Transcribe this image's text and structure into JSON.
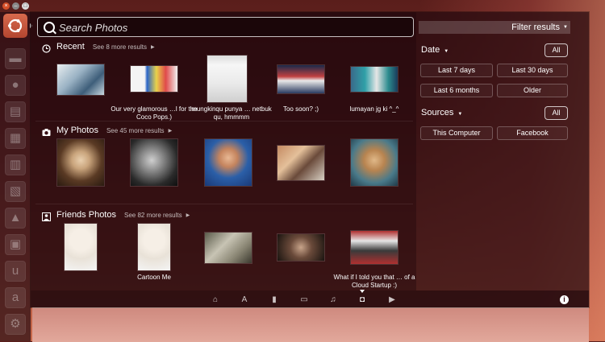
{
  "launcher": {
    "items": [
      "home-folder",
      "firefox",
      "files",
      "text-editor",
      "document",
      "spreadsheet",
      "presentation",
      "software-center",
      "ubuntu-one",
      "amazon",
      "settings"
    ]
  },
  "search": {
    "placeholder": "Search Photos",
    "value": ""
  },
  "categories": [
    {
      "title": "Recent",
      "more": "See 8 more results",
      "items": [
        {
          "caption": ""
        },
        {
          "caption": "Our very glamorous …l for the Coco Pops.)"
        },
        {
          "caption": "mungkinqu punya … netbuk qu, hmmmm"
        },
        {
          "caption": "Too soon? ;)"
        },
        {
          "caption": "lumayan jg ki ^_^"
        }
      ]
    },
    {
      "title": "My Photos",
      "more": "See 45 more results",
      "items": [
        {
          "caption": ""
        },
        {
          "caption": ""
        },
        {
          "caption": ""
        },
        {
          "caption": ""
        },
        {
          "caption": ""
        }
      ]
    },
    {
      "title": "Friends Photos",
      "more": "See 82 more results",
      "items": [
        {
          "caption": ""
        },
        {
          "caption": "Cartoon Me"
        },
        {
          "caption": ""
        },
        {
          "caption": ""
        },
        {
          "caption": "What if I told you that … of a Cloud Startup :)"
        }
      ]
    }
  ],
  "filters": {
    "header": "Filter results",
    "date": {
      "label": "Date",
      "all": "All",
      "options": [
        "Last 7 days",
        "Last 30 days",
        "Last 6 months",
        "Older"
      ]
    },
    "sources": {
      "label": "Sources",
      "all": "All",
      "options": [
        "This Computer",
        "Facebook"
      ]
    }
  },
  "lenses": [
    "home-lens",
    "applications-lens",
    "files-lens",
    "social-lens",
    "music-lens",
    "photos-lens",
    "video-lens"
  ],
  "active_lens": "photos-lens",
  "colors": {
    "accent": "#d6502a",
    "panel": "#23080e"
  }
}
